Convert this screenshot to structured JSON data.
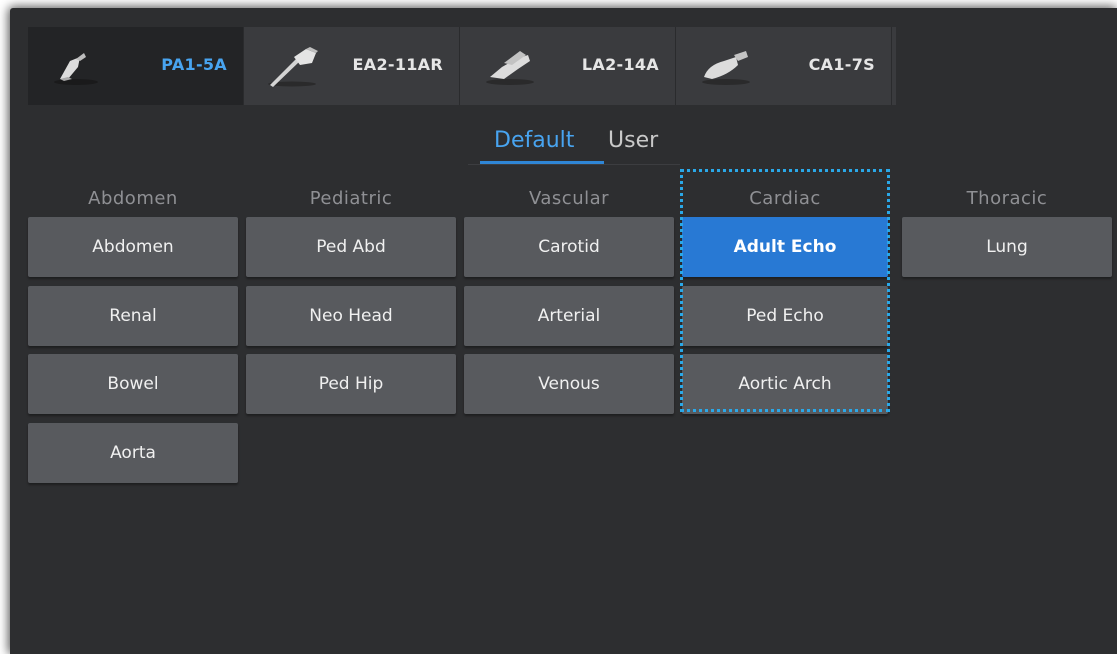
{
  "probes": [
    {
      "name": "PA1-5A",
      "icon": "phased-array-probe-icon",
      "active": true
    },
    {
      "name": "EA2-11AR",
      "icon": "endocavity-probe-icon",
      "active": false
    },
    {
      "name": "LA2-14A",
      "icon": "linear-probe-icon",
      "active": false
    },
    {
      "name": "CA1-7S",
      "icon": "convex-probe-icon",
      "active": false
    }
  ],
  "preset_tabs": {
    "default_label": "Default",
    "user_label": "User",
    "selected": "Default"
  },
  "categories": [
    {
      "title": "Abdomen",
      "exams": [
        "Abdomen",
        "Renal",
        "Bowel",
        "Aorta"
      ]
    },
    {
      "title": "Pediatric",
      "exams": [
        "Ped Abd",
        "Neo Head",
        "Ped Hip"
      ]
    },
    {
      "title": "Vascular",
      "exams": [
        "Carotid",
        "Arterial",
        "Venous"
      ]
    },
    {
      "title": "Cardiac",
      "exams": [
        "Adult Echo",
        "Ped Echo",
        "Aortic Arch"
      ]
    },
    {
      "title": "Thoracic",
      "exams": [
        "Lung"
      ]
    }
  ],
  "selected_exam": "Adult Echo",
  "colors": {
    "accent": "#48a4f0",
    "selected_button": "#2879d4",
    "focus_ring": "#2aa8e8"
  }
}
